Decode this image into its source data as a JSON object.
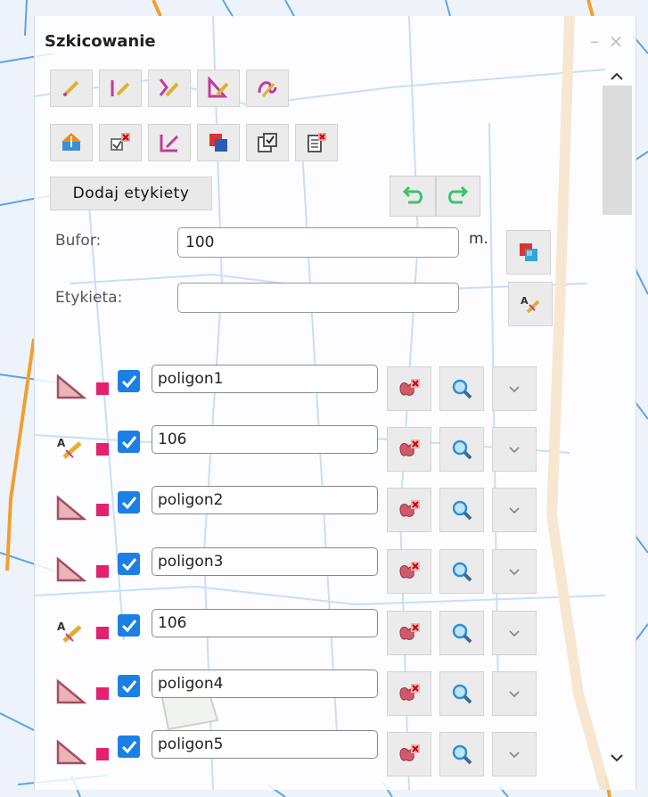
{
  "panel": {
    "title": "Szkicowanie",
    "minimize_glyph": "–",
    "close_glyph": "×"
  },
  "toolbar_row1": [
    {
      "icon": "draw-point-icon"
    },
    {
      "icon": "draw-line-icon"
    },
    {
      "icon": "draw-polyline-icon"
    },
    {
      "icon": "draw-polygon-icon"
    },
    {
      "icon": "draw-freehand-icon"
    }
  ],
  "toolbar_row2": [
    {
      "icon": "import-icon"
    },
    {
      "icon": "delete-selected-icon"
    },
    {
      "icon": "edit-shape-icon"
    },
    {
      "icon": "intersect-icon"
    },
    {
      "icon": "copy-selected-icon"
    },
    {
      "icon": "delete-all-icon"
    }
  ],
  "add_labels_button": "Dodaj etykiety",
  "buffer": {
    "label": "Bufor:",
    "value": "100",
    "unit": "m."
  },
  "label_field": {
    "label": "Etykieta:",
    "value": ""
  },
  "items": [
    {
      "type": "polygon",
      "name": "poligon1",
      "checked": true
    },
    {
      "type": "label",
      "name": "106",
      "checked": true
    },
    {
      "type": "polygon",
      "name": "poligon2",
      "checked": true
    },
    {
      "type": "polygon",
      "name": "poligon3",
      "checked": true
    },
    {
      "type": "label",
      "name": "106",
      "checked": true
    },
    {
      "type": "polygon",
      "name": "poligon4",
      "checked": true
    },
    {
      "type": "polygon",
      "name": "poligon5",
      "checked": true
    }
  ],
  "colors": {
    "accent": "#e5206e",
    "checkbox": "#1b7fe6",
    "road": "#f0a030",
    "map_line": "#3a8fd8"
  }
}
